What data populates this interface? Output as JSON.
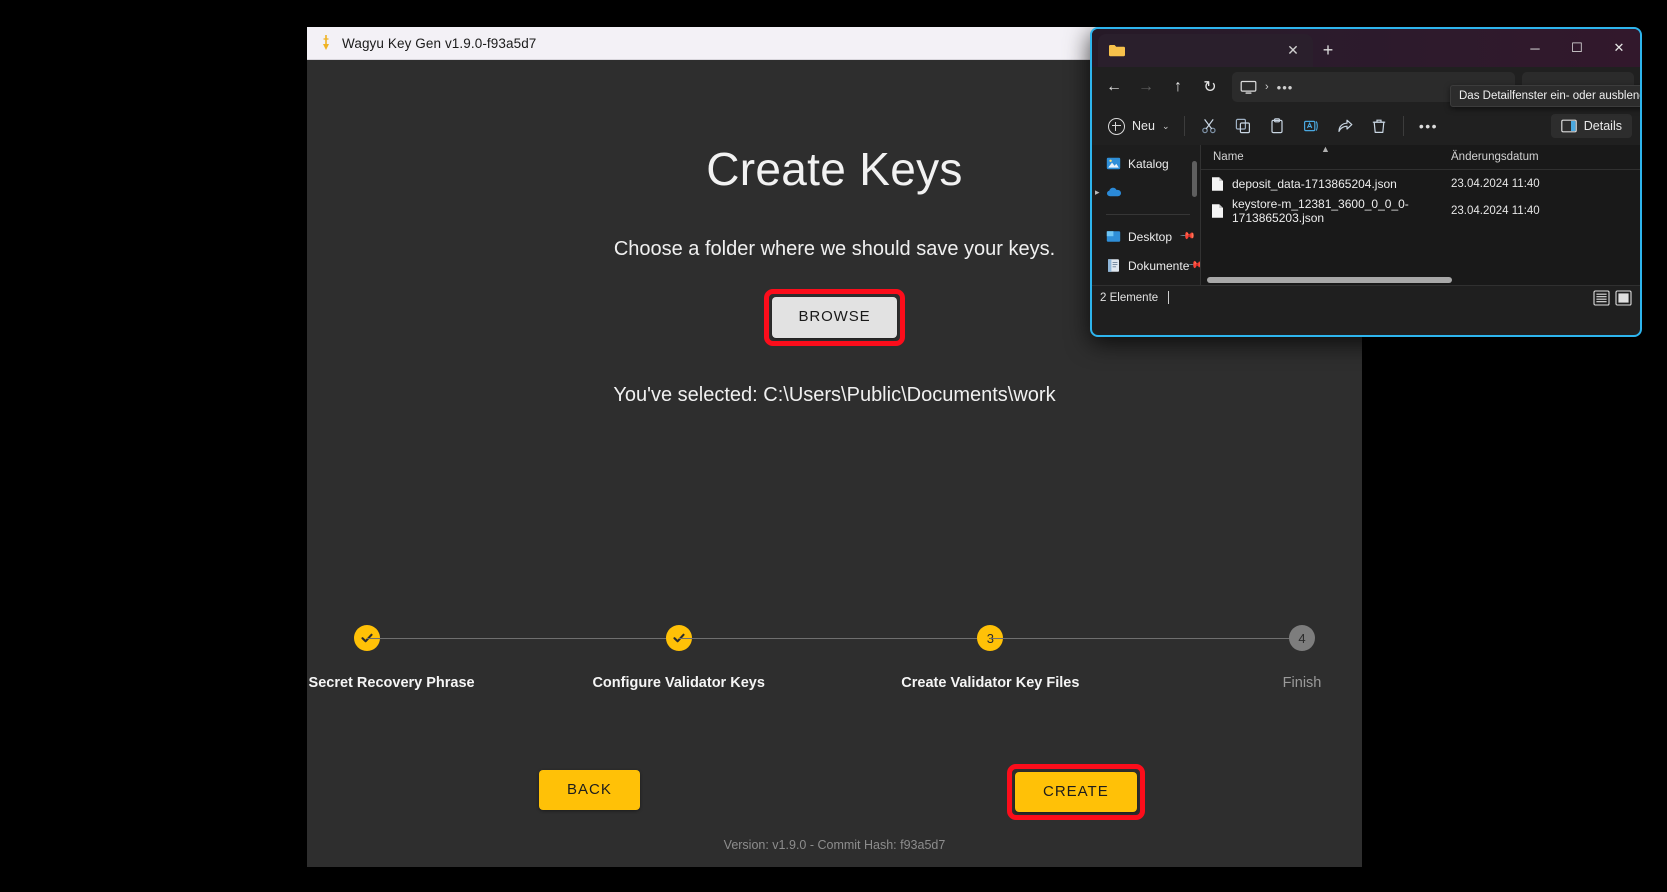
{
  "app": {
    "title": "Wagyu Key Gen v1.9.0-f93a5d7",
    "title_icon": "wagyu-key-icon",
    "page_title": "Create Keys",
    "subtitle": "Choose a folder where we should save your keys.",
    "browse_label": "BROWSE",
    "selected_text": "You've selected: C:\\Users\\Public\\Documents\\work",
    "version_text": "Version: v1.9.0 - Commit Hash: f93a5d7",
    "accent_color": "#ffc107",
    "highlight_color": "#fc0d1b",
    "background_color": "#2e2e2e",
    "buttons": {
      "back_label": "BACK",
      "create_label": "CREATE"
    },
    "stepper": [
      {
        "marker": "✓",
        "label": "Create Secret Recovery Phrase",
        "state": "done"
      },
      {
        "marker": "✓",
        "label": "Configure Validator Keys",
        "state": "done"
      },
      {
        "marker": "3",
        "label": "Create Validator Key Files",
        "state": "active"
      },
      {
        "marker": "4",
        "label": "Finish",
        "state": "todo"
      }
    ]
  },
  "explorer": {
    "tab": {
      "close_label": "✕",
      "new_tab_label": "+"
    },
    "window_controls": {
      "minimize": "─",
      "maximize": "☐",
      "close": "✕"
    },
    "nav": {
      "back": "←",
      "forward": "→",
      "up": "↑",
      "refresh": "↻",
      "address_chevron": "›",
      "address_dots": "•••"
    },
    "toolbar": {
      "new_label": "Neu",
      "new_chevron": "⌄",
      "more_label": "•••",
      "details_label": "Details",
      "tooltip": "Das Detailfenster ein- oder ausblenden"
    },
    "sidebar": [
      {
        "label": "Katalog",
        "icon": "picture-icon",
        "pinned": false,
        "expandable": false
      },
      {
        "label": "",
        "icon": "onedrive-cloud-icon",
        "pinned": false,
        "expandable": true
      },
      {
        "label": "Desktop",
        "icon": "desktop-icon",
        "pinned": true,
        "expandable": false
      },
      {
        "label": "Dokumente",
        "icon": "documents-icon",
        "pinned": true,
        "expandable": false
      }
    ],
    "columns": {
      "name": "Name",
      "date": "Änderungsdatum"
    },
    "files": [
      {
        "name": "deposit_data-1713865204.json",
        "date": "23.04.2024 11:40",
        "icon": "json-file-icon"
      },
      {
        "name": "keystore-m_12381_3600_0_0_0-1713865203.json",
        "date": "23.04.2024 11:40",
        "icon": "json-file-icon"
      }
    ],
    "status": {
      "items_label": "2 Elemente"
    }
  }
}
